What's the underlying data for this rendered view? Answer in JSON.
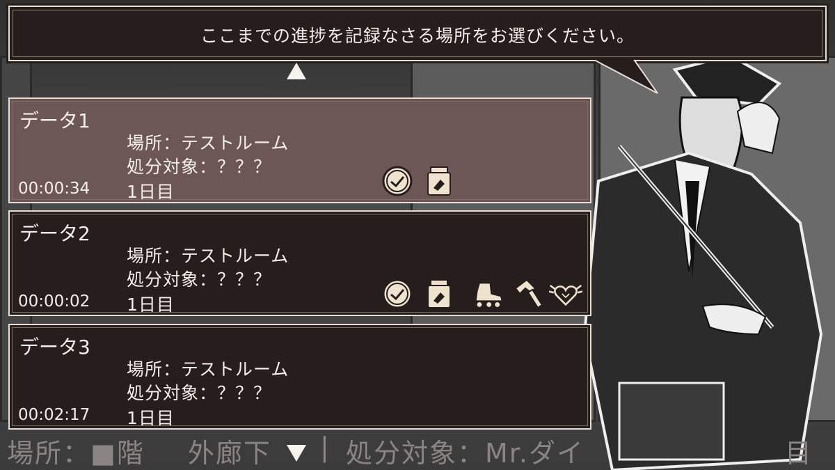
{
  "dialog": {
    "message": "ここまでの進捗を記録なさる場所をお選びください。"
  },
  "slots": [
    {
      "title": "データ1",
      "location": "場所：テストルーム",
      "target": "処分対象：？？？",
      "time": "00:00:34",
      "day": "1日目",
      "selected": true,
      "items": [
        "clock-icon",
        "jar-icon"
      ]
    },
    {
      "title": "データ2",
      "location": "場所：テストルーム",
      "target": "処分対象：？？？",
      "time": "00:00:02",
      "day": "1日目",
      "selected": false,
      "items": [
        "clock-icon",
        "jar-icon",
        "roller-skate-icon",
        "hammer-icon",
        "winged-heart-icon"
      ]
    },
    {
      "title": "データ3",
      "location": "場所：テストルーム",
      "target": "処分対象：？？？",
      "time": "00:02:17",
      "day": "1日目",
      "selected": false,
      "items": []
    }
  ],
  "status_bar": {
    "location": "場所：■階",
    "floor": "外廊下",
    "separator": "|",
    "target": "処分対象：Mr.ダイ",
    "day": "目"
  },
  "colors": {
    "panel": "#261d1d",
    "selected": "#6d5656",
    "border": "#e8ddd2",
    "text": "#f3eee9",
    "icon": "#efe3cf"
  }
}
